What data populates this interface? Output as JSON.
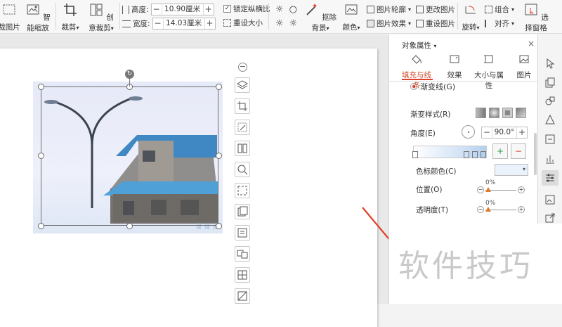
{
  "ribbon": {
    "crop_image": "裁图片",
    "smart_zoom": "智能缩放",
    "crop": "裁剪",
    "creative_crop": "创意裁剪",
    "height_label": "高度:",
    "height_value": "10.90厘米",
    "width_label": "宽度:",
    "width_value": "14.03厘米",
    "lock_ratio": "锁定纵横比",
    "reset_size": "重设大小",
    "remove_bg": "抠除背景",
    "color": "颜色",
    "picture_outline": "图片轮廓",
    "picture_effects": "图片效果",
    "change_picture": "更改图片",
    "reset_picture": "重设图片",
    "rotate": "旋转",
    "group": "组合",
    "align": "对齐",
    "selection_pane": "选择窗格"
  },
  "panel": {
    "title": "对象属性",
    "tabs": [
      "填充与线条",
      "效果",
      "大小与属性",
      "图片"
    ],
    "gradient_line": "渐变线(G)",
    "gradient_style": "渐变样式(R)",
    "angle_label": "角度(E)",
    "angle_value": "90.0°",
    "stop_color_label": "色标颜色(C)",
    "position_label": "位置(O)",
    "position_value": "0%",
    "transparency_label": "透明度(T)",
    "transparency_value": "0%"
  },
  "watermark": "软件技巧",
  "colors": {
    "accent": "#e0412b",
    "selection": "#6f6f6f"
  }
}
